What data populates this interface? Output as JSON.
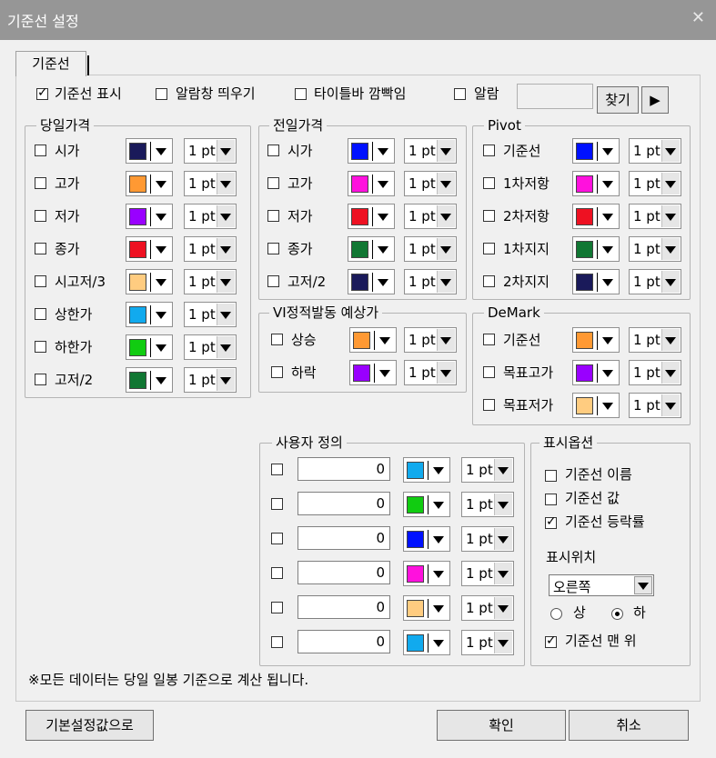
{
  "window": {
    "title": "기준선 설정",
    "close_label": "✕"
  },
  "tab": {
    "label": "기준선"
  },
  "top_options": {
    "show_baseline": {
      "label": "기준선 표시",
      "checked": true
    },
    "alert_popup": {
      "label": "알람창 띄우기",
      "checked": false
    },
    "titlebar_blink": {
      "label": "타이틀바 깜빡임",
      "checked": false
    },
    "alarm": {
      "label": "알람",
      "checked": false
    },
    "find_button": "찾기",
    "play_button": "▶"
  },
  "groups": {
    "today": {
      "title": "당일가격",
      "items": [
        {
          "label": "시가",
          "color": "#1a1a5a",
          "width": "1 pt"
        },
        {
          "label": "고가",
          "color": "#ff9933",
          "width": "1 pt"
        },
        {
          "label": "저가",
          "color": "#9900ff",
          "width": "1 pt"
        },
        {
          "label": "종가",
          "color": "#ee1122",
          "width": "1 pt"
        },
        {
          "label": "시고저/3",
          "color": "#ffcc80",
          "width": "1 pt"
        },
        {
          "label": "상한가",
          "color": "#11aaee",
          "width": "1 pt"
        },
        {
          "label": "하한가",
          "color": "#11cc11",
          "width": "1 pt"
        },
        {
          "label": "고저/2",
          "color": "#117733",
          "width": "1 pt"
        }
      ]
    },
    "prev": {
      "title": "전일가격",
      "items": [
        {
          "label": "시가",
          "color": "#0011ff",
          "width": "1 pt"
        },
        {
          "label": "고가",
          "color": "#ff11dd",
          "width": "1 pt"
        },
        {
          "label": "저가",
          "color": "#ee1122",
          "width": "1 pt"
        },
        {
          "label": "종가",
          "color": "#117733",
          "width": "1 pt"
        },
        {
          "label": "고저/2",
          "color": "#1a1a5a",
          "width": "1 pt"
        }
      ]
    },
    "vi": {
      "title": "VI정적발동 예상가",
      "items": [
        {
          "label": "상승",
          "color": "#ff9933",
          "width": "1 pt"
        },
        {
          "label": "하락",
          "color": "#9900ff",
          "width": "1 pt"
        }
      ]
    },
    "pivot": {
      "title": "Pivot",
      "items": [
        {
          "label": "기준선",
          "color": "#0011ff",
          "width": "1 pt"
        },
        {
          "label": "1차저항",
          "color": "#ff11dd",
          "width": "1 pt"
        },
        {
          "label": "2차저항",
          "color": "#ee1122",
          "width": "1 pt"
        },
        {
          "label": "1차지지",
          "color": "#117733",
          "width": "1 pt"
        },
        {
          "label": "2차지지",
          "color": "#1a1a5a",
          "width": "1 pt"
        }
      ]
    },
    "demark": {
      "title": "DeMark",
      "items": [
        {
          "label": "기준선",
          "color": "#ff9933",
          "width": "1 pt"
        },
        {
          "label": "목표고가",
          "color": "#9900ff",
          "width": "1 pt"
        },
        {
          "label": "목표저가",
          "color": "#ffcc80",
          "width": "1 pt"
        }
      ]
    },
    "user": {
      "title": "사용자 정의",
      "items": [
        {
          "value": "0",
          "color": "#11aaee",
          "width": "1 pt"
        },
        {
          "value": "0",
          "color": "#11cc11",
          "width": "1 pt"
        },
        {
          "value": "0",
          "color": "#0011ff",
          "width": "1 pt"
        },
        {
          "value": "0",
          "color": "#ff11dd",
          "width": "1 pt"
        },
        {
          "value": "0",
          "color": "#ffcc80",
          "width": "1 pt"
        },
        {
          "value": "0",
          "color": "#11aaee",
          "width": "1 pt"
        }
      ]
    },
    "display": {
      "title": "표시옵션",
      "name": {
        "label": "기준선 이름",
        "checked": false
      },
      "value": {
        "label": "기준선 값",
        "checked": false
      },
      "rate": {
        "label": "기준선 등락률",
        "checked": true
      },
      "position_label": "표시위치",
      "position_value": "오른쪽",
      "up": {
        "label": "상",
        "selected": false
      },
      "down": {
        "label": "하",
        "selected": true
      },
      "top_most": {
        "label": "기준선 맨 위",
        "checked": true
      }
    }
  },
  "note": "※모든 데이터는 당일 일봉 기준으로 계산 됩니다.",
  "buttons": {
    "defaults": "기본설정값으로",
    "ok": "확인",
    "cancel": "취소"
  }
}
